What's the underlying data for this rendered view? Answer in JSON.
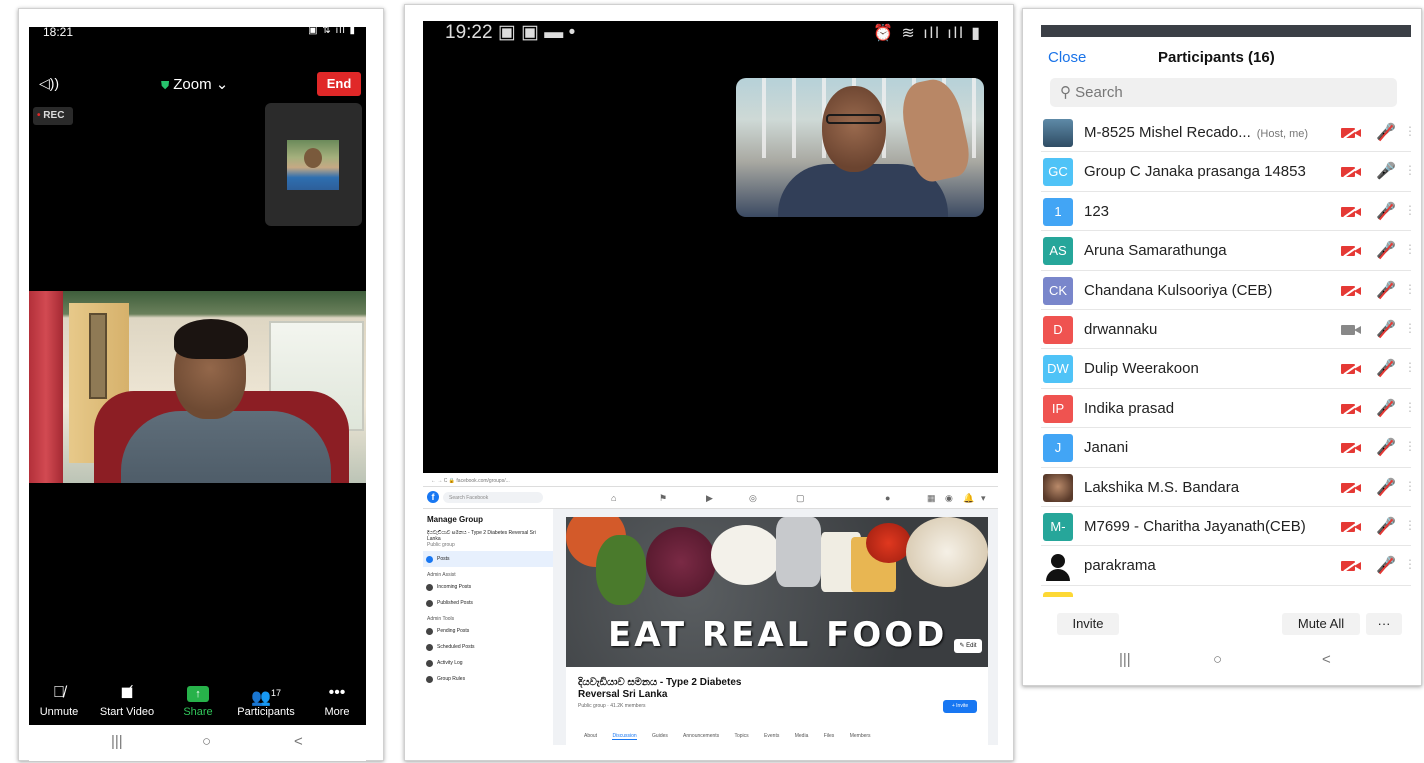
{
  "zoom_call": {
    "status_time": "18:21",
    "title": "Zoom",
    "end_label": "End",
    "rec_label": "REC",
    "toolbar": [
      {
        "key": "unmute",
        "label": "Unmute",
        "icon": "mic-off-icon"
      },
      {
        "key": "start_video",
        "label": "Start Video",
        "icon": "video-off-icon"
      },
      {
        "key": "share",
        "label": "Share",
        "icon": "share-icon"
      },
      {
        "key": "participants",
        "label": "Participants",
        "icon": "participants-icon",
        "count": "17"
      },
      {
        "key": "more",
        "label": "More",
        "icon": "more-icon"
      }
    ],
    "nav": [
      "|||",
      "○",
      "<"
    ]
  },
  "video_call": {
    "status_time": "19:22"
  },
  "facebook": {
    "search_placeholder": "Search Facebook",
    "sidebar_title": "Manage Group",
    "group_short": "දියවැඩියාව සමනය - Type 2 Diabetes Reversal Sri Lanka",
    "group_privacy": "Public group",
    "menu": [
      {
        "label": "Posts",
        "active": true
      },
      {
        "section": "Admin Assist"
      },
      {
        "label": "Incoming Posts"
      },
      {
        "label": "Published Posts"
      },
      {
        "section": "Admin Tools"
      },
      {
        "label": "Pending Posts"
      },
      {
        "label": "Scheduled Posts"
      },
      {
        "label": "Activity Log"
      },
      {
        "label": "Group Rules"
      }
    ],
    "cover_text": "EAT REAL FOOD",
    "edit_label": "Edit",
    "group_title_line1": "දියවැඩියාව සමනය - Type 2 Diabetes",
    "group_title_line2": "Reversal Sri Lanka",
    "group_meta": "Public group · 41.2K members",
    "invite_label": "+ Invite",
    "tabs": [
      "About",
      "Discussion",
      "Guides",
      "Announcements",
      "Topics",
      "Events",
      "Media",
      "Files",
      "Members"
    ],
    "active_tab": "Discussion"
  },
  "participants_panel": {
    "close_label": "Close",
    "title": "Participants (16)",
    "search_placeholder": "Search",
    "participants": [
      {
        "initials": "",
        "avatar": "photo",
        "name": "M-8525 Mishel Recado...",
        "tag": "(Host, me)",
        "video": false,
        "mic": false
      },
      {
        "initials": "GC",
        "color": "#4fc3f7",
        "name": "Group C  Janaka prasanga 14853",
        "video": false,
        "mic": true
      },
      {
        "initials": "1",
        "color": "#42a5f5",
        "name": "123",
        "video": false,
        "mic": false
      },
      {
        "initials": "AS",
        "color": "#26a69a",
        "name": "Aruna Samarathunga",
        "video": false,
        "mic": false
      },
      {
        "initials": "CK",
        "color": "#7986cb",
        "name": "Chandana Kulsooriya (CEB)",
        "video": false,
        "mic": false
      },
      {
        "initials": "D",
        "color": "#ef5350",
        "name": "drwannaku",
        "video": true,
        "mic": false
      },
      {
        "initials": "DW",
        "color": "#4fc3f7",
        "name": "Dulip Weerakoon",
        "video": false,
        "mic": false
      },
      {
        "initials": "IP",
        "color": "#ef5350",
        "name": "Indika prasad",
        "video": false,
        "mic": false
      },
      {
        "initials": "J",
        "color": "#42a5f5",
        "name": "Janani",
        "video": false,
        "mic": false
      },
      {
        "initials": "",
        "avatar": "photo2",
        "name": "Lakshika M.S. Bandara",
        "video": false,
        "mic": false
      },
      {
        "initials": "M-",
        "color": "#26a69a",
        "name": "M7699 - Charitha Jayanath(CEB)",
        "video": false,
        "mic": false
      },
      {
        "initials": "",
        "avatar": "person",
        "name": "parakrama",
        "video": false,
        "mic": false
      }
    ],
    "invite_label": "Invite",
    "mute_all_label": "Mute All",
    "more_label": "···",
    "nav": [
      "|||",
      "○",
      "<"
    ]
  }
}
